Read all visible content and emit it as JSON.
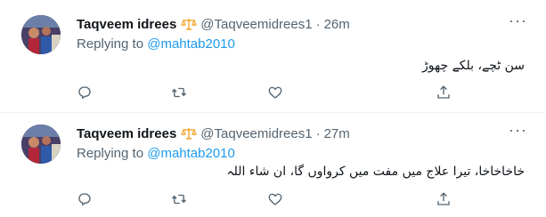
{
  "tweets": [
    {
      "display_name": "Taqveem idrees",
      "badge_icon": "scales-icon",
      "handle": "@Taqveemidrees1",
      "separator": "·",
      "time": "26m",
      "replying_prefix": "Replying to",
      "replying_to": "@mahtab2010",
      "text": "سن ٹچے، بلکے چھوڑ"
    },
    {
      "display_name": "Taqveem idrees",
      "badge_icon": "scales-icon",
      "handle": "@Taqveemidrees1",
      "separator": "·",
      "time": "27m",
      "replying_prefix": "Replying to",
      "replying_to": "@mahtab2010",
      "text": "خاخاخاخا، تیرا علاج میں مفت میں کرواوں گا، ان شاء اللہ"
    }
  ],
  "icons": {
    "more": "more-dots-icon",
    "reply": "reply-icon",
    "retweet": "retweet-icon",
    "like": "heart-icon",
    "share": "share-icon"
  },
  "colors": {
    "accent": "#1d9bf0",
    "secondary_text": "#536471",
    "badge": "#f4a52b",
    "divider": "#eff3f4"
  }
}
